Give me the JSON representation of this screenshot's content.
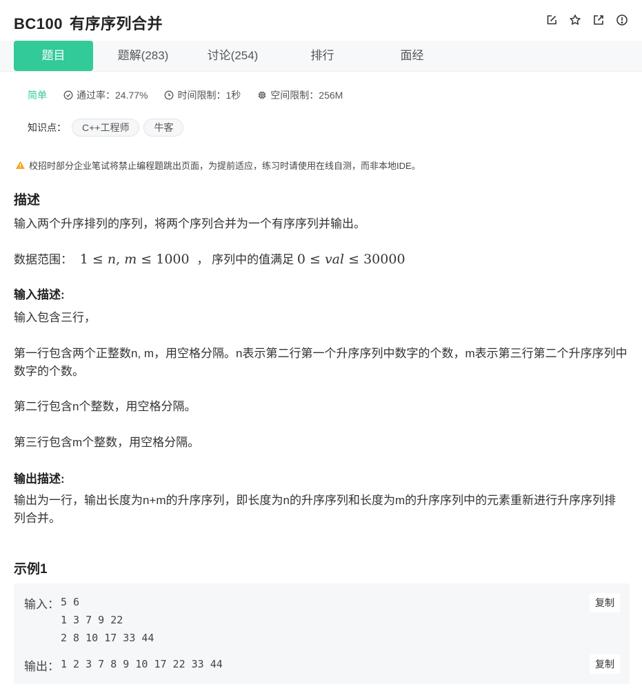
{
  "header": {
    "problem_id": "BC100",
    "problem_title": "有序序列合并",
    "icons": [
      "edit-icon",
      "star-icon",
      "share-icon",
      "info-icon"
    ]
  },
  "tabs": [
    {
      "label": "题目",
      "active": true
    },
    {
      "label": "题解(283)",
      "active": false
    },
    {
      "label": "讨论(254)",
      "active": false
    },
    {
      "label": "排行",
      "active": false
    },
    {
      "label": "面经",
      "active": false
    }
  ],
  "meta": {
    "difficulty": "简单",
    "pass_rate": "通过率：24.77%",
    "time_limit": "时间限制：1秒",
    "memory_limit": "空间限制：256M"
  },
  "knowledge": {
    "label": "知识点：",
    "tags": [
      "C++工程师",
      "牛客"
    ]
  },
  "warning": "校招时部分企业笔试将禁止编程题跳出页面，为提前适应，练习时请使用在线自测，而非本地IDE。",
  "description": {
    "heading": "描述",
    "text": "输入两个升序排列的序列，将两个序列合并为一个有序序列并输出。",
    "range_prefix": "数据范围：",
    "range_mid": "，  序列中的值满足"
  },
  "input_desc": {
    "heading": "输入描述:",
    "lines": [
      "输入包含三行，",
      "第一行包含两个正整数n, m，用空格分隔。n表示第二行第一个升序序列中数字的个数，m表示第三行第二个升序序列中数字的个数。",
      "第二行包含n个整数，用空格分隔。",
      "第三行包含m个整数，用空格分隔。"
    ]
  },
  "output_desc": {
    "heading": "输出描述:",
    "text": "输出为一行，输出长度为n+m的升序序列，即长度为n的升序序列和长度为m的升序序列中的元素重新进行升序序列排列合并。"
  },
  "example": {
    "heading": "示例1",
    "input_label": "输入：",
    "input_lines": [
      "5 6",
      "1 3 7 9 22",
      "2 8 10 17 33 44"
    ],
    "output_label": "输出：",
    "output_line": "1 2 3 7 8 9 10 17 22 33 44",
    "copy_label": "复制"
  },
  "colors": {
    "accent": "#32ca99",
    "warning": "#f5a623"
  }
}
